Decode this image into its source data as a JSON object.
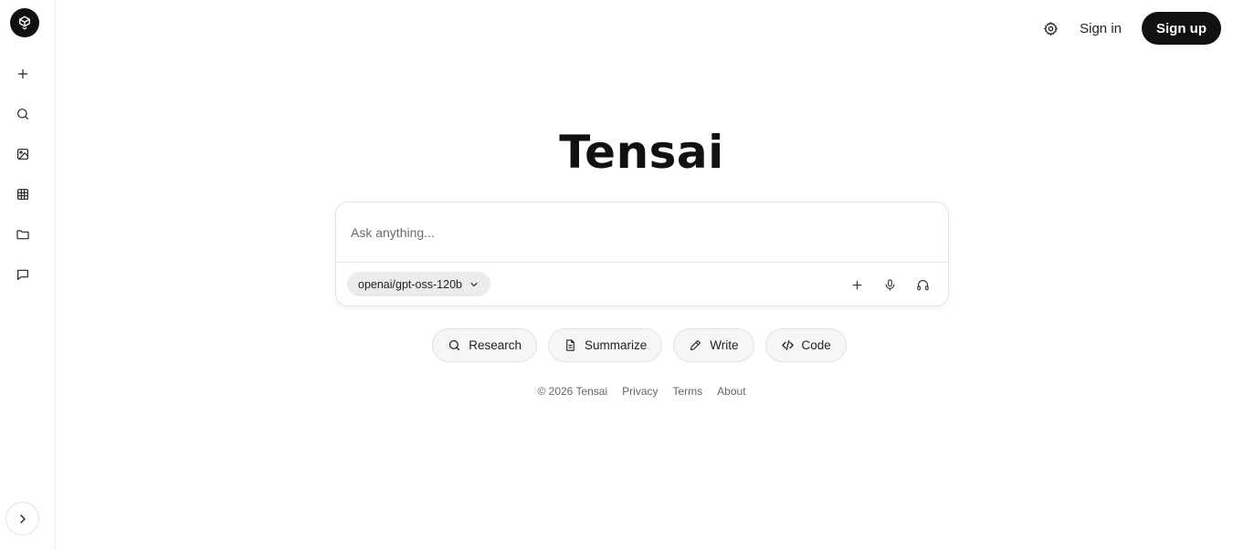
{
  "sidebar": {
    "logo": "tensai-logo-icon",
    "items": [
      {
        "name": "new-chat",
        "icon": "plus-icon"
      },
      {
        "name": "search",
        "icon": "search-icon"
      },
      {
        "name": "images",
        "icon": "image-icon"
      },
      {
        "name": "tables",
        "icon": "grid-icon"
      },
      {
        "name": "files",
        "icon": "folder-icon"
      },
      {
        "name": "chats",
        "icon": "message-square-icon"
      }
    ],
    "expand_icon": "chevron-right-icon"
  },
  "header": {
    "settings_icon": "gear-icon",
    "sign_in_label": "Sign in",
    "sign_up_label": "Sign up"
  },
  "main": {
    "title": "Tensai",
    "composer": {
      "placeholder": "Ask anything...",
      "value": "",
      "model_label": "openai/gpt-oss-120b",
      "tools": [
        "plus-icon",
        "microphone-icon",
        "headphones-icon"
      ]
    },
    "suggestions": [
      {
        "label": "Research",
        "icon": "search-icon"
      },
      {
        "label": "Summarize",
        "icon": "document-icon"
      },
      {
        "label": "Write",
        "icon": "pencil-icon"
      },
      {
        "label": "Code",
        "icon": "code-icon"
      }
    ]
  },
  "footer": {
    "copyright": "© 2026 Tensai",
    "links": [
      "Privacy",
      "Terms",
      "About"
    ]
  },
  "colors": {
    "accent": "#111111",
    "chip_bg": "#f6f6f6",
    "border": "#e3e3e3"
  }
}
